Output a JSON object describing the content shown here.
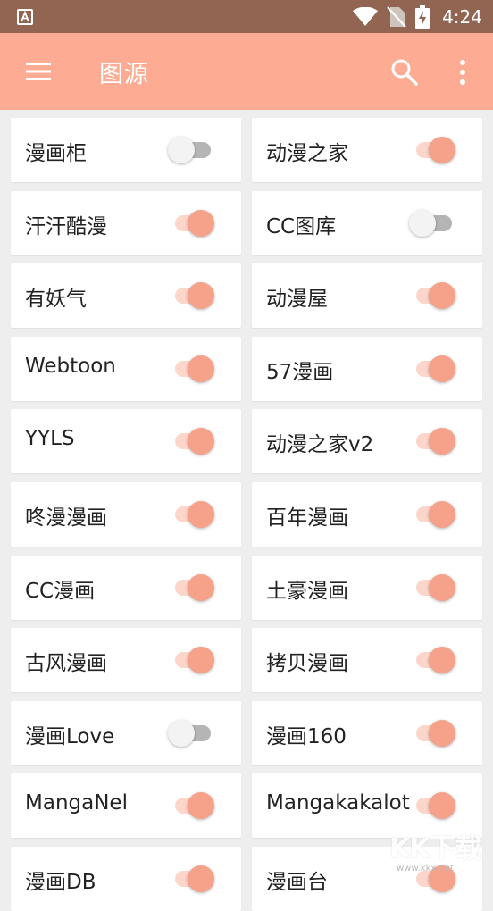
{
  "status_bar": {
    "time": "4:24"
  },
  "app_bar": {
    "title": "图源"
  },
  "sources": [
    {
      "name": "漫画柜",
      "enabled": false
    },
    {
      "name": "动漫之家",
      "enabled": true
    },
    {
      "name": "汗汗酷漫",
      "enabled": true
    },
    {
      "name": "CC图库",
      "enabled": false
    },
    {
      "name": "有妖气",
      "enabled": true
    },
    {
      "name": "动漫屋",
      "enabled": true
    },
    {
      "name": "Webtoon",
      "enabled": true
    },
    {
      "name": "57漫画",
      "enabled": true
    },
    {
      "name": "YYLS",
      "enabled": true
    },
    {
      "name": "动漫之家v2",
      "enabled": true
    },
    {
      "name": "咚漫漫画",
      "enabled": true
    },
    {
      "name": "百年漫画",
      "enabled": true
    },
    {
      "name": "CC漫画",
      "enabled": true
    },
    {
      "name": "土豪漫画",
      "enabled": true
    },
    {
      "name": "古风漫画",
      "enabled": true
    },
    {
      "name": "拷贝漫画",
      "enabled": true
    },
    {
      "name": "漫画Love",
      "enabled": false
    },
    {
      "name": "漫画160",
      "enabled": true
    },
    {
      "name": "MangaNel",
      "enabled": true
    },
    {
      "name": "Mangakakalot",
      "enabled": true
    },
    {
      "name": "漫画DB",
      "enabled": true
    },
    {
      "name": "漫画台",
      "enabled": true
    }
  ],
  "watermark": {
    "main": "KK下载",
    "sub": "www.kkx.net"
  },
  "colors": {
    "status_bar": "#916552",
    "app_bar": "#fdab92",
    "switch_on_thumb": "#f6a28a",
    "switch_on_track": "#fcd6ca",
    "switch_off_thumb": "#f3f3f3",
    "switch_off_track": "#b5b5b5",
    "background": "#eeeeee"
  },
  "icons": [
    "app-notification-icon",
    "wifi-icon",
    "no-sim-icon",
    "battery-charging-icon",
    "menu-icon",
    "search-icon",
    "more-vert-icon"
  ]
}
